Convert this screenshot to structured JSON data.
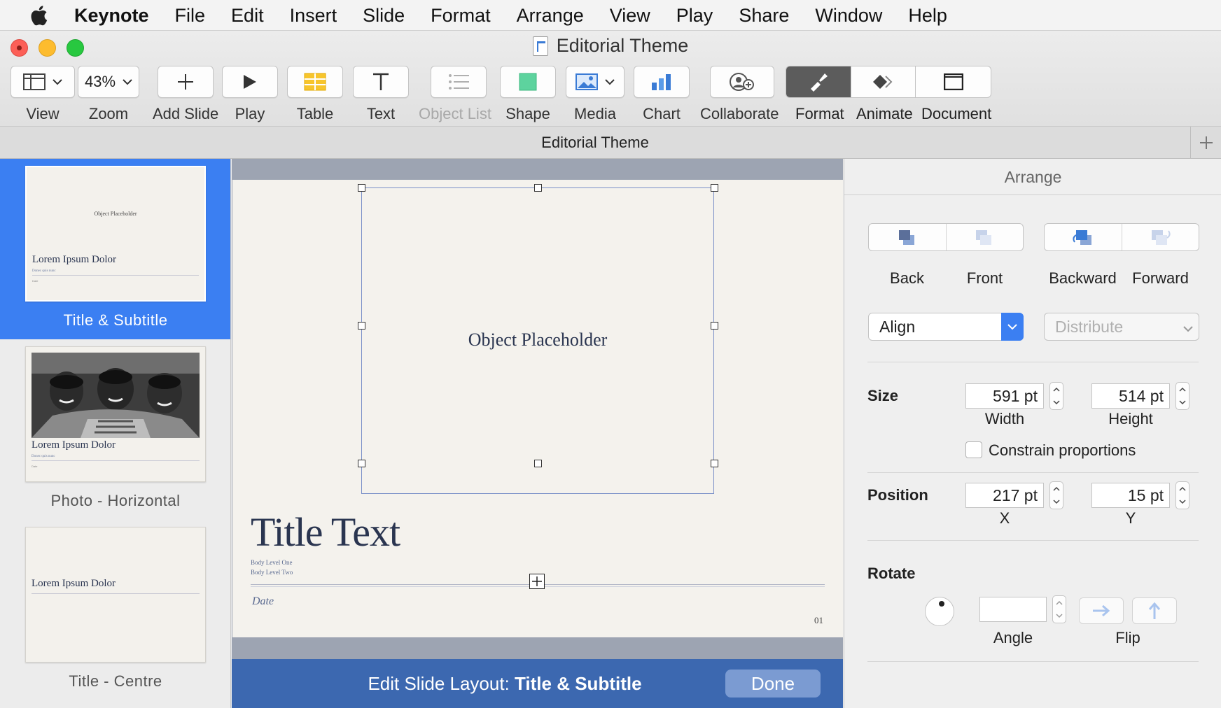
{
  "menubar": {
    "app": "Keynote",
    "items": [
      "File",
      "Edit",
      "Insert",
      "Slide",
      "Format",
      "Arrange",
      "View",
      "Play",
      "Share",
      "Window",
      "Help"
    ]
  },
  "window": {
    "title": "Editorial Theme"
  },
  "toolbar": {
    "view": "View",
    "zoom": "Zoom",
    "zoom_value": "43%",
    "add_slide": "Add Slide",
    "play": "Play",
    "table": "Table",
    "text": "Text",
    "object_list": "Object List",
    "shape": "Shape",
    "media": "Media",
    "chart": "Chart",
    "collaborate": "Collaborate",
    "format": "Format",
    "animate": "Animate",
    "document": "Document"
  },
  "tabbar": {
    "title": "Editorial Theme"
  },
  "navigator": {
    "items": [
      {
        "label": "Title & Subtitle",
        "thumb_object": "Object Placeholder",
        "thumb_title": "Lorem Ipsum Dolor",
        "thumb_sub": "Donec quis nunc",
        "thumb_date": "Date"
      },
      {
        "label": "Photo - Horizontal",
        "thumb_title": "Lorem Ipsum Dolor",
        "thumb_sub": "Donec quis nunc",
        "thumb_date": "Date"
      },
      {
        "label": "Title - Centre",
        "thumb_title": "Lorem Ipsum Dolor"
      }
    ]
  },
  "slide": {
    "object_placeholder": "Object Placeholder",
    "title": "Title Text",
    "body_level_one": "Body Level One",
    "body_level_two": "Body Level Two",
    "date": "Date",
    "number": "01"
  },
  "edit_bar": {
    "prefix": "Edit Slide Layout: ",
    "layout_name": "Title & Subtitle",
    "done": "Done"
  },
  "inspector": {
    "header": "Arrange",
    "back": "Back",
    "front": "Front",
    "backward": "Backward",
    "forward": "Forward",
    "align": "Align",
    "distribute": "Distribute",
    "size_label": "Size",
    "width_value": "591 pt",
    "width_label": "Width",
    "height_value": "514 pt",
    "height_label": "Height",
    "constrain": "Constrain proportions",
    "position_label": "Position",
    "x_value": "217 pt",
    "x_label": "X",
    "y_value": "15 pt",
    "y_label": "Y",
    "rotate_label": "Rotate",
    "angle_value": "",
    "angle_label": "Angle",
    "flip_label": "Flip"
  },
  "colors": {
    "accent": "#3b7ff2",
    "edit_bar": "#3c68b0",
    "slide_text": "#2a3550"
  }
}
